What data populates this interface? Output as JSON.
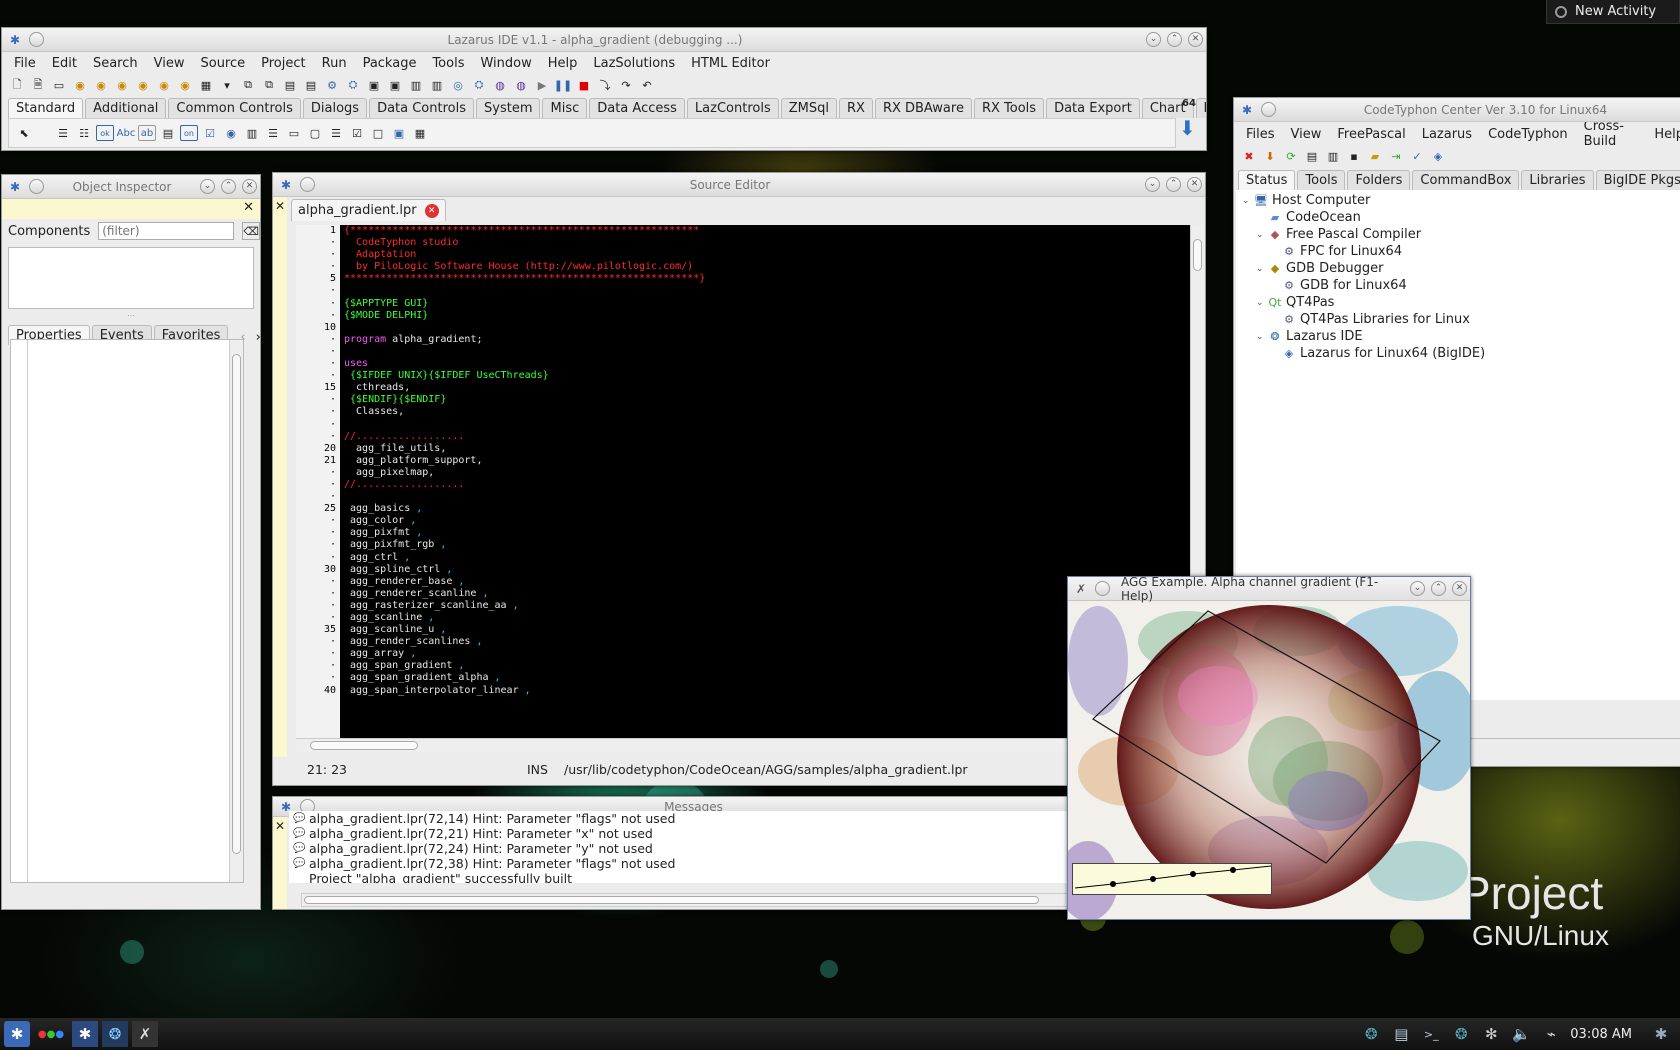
{
  "desktop": {
    "watermark_project": "Project",
    "watermark_os": "GNU/Linux",
    "new_activity": "New Activity"
  },
  "ide": {
    "title": "Lazarus IDE v1.1 - alpha_gradient (debugging ...)",
    "menu": [
      "File",
      "Edit",
      "Search",
      "View",
      "Source",
      "Project",
      "Run",
      "Package",
      "Tools",
      "Window",
      "Help",
      "LazSolutions",
      "HTML Editor"
    ],
    "palette_tabs": [
      "Standard",
      "Additional",
      "Common Controls",
      "Dialogs",
      "Data Controls",
      "System",
      "Misc",
      "Data Access",
      "LazControls",
      "ZMSql",
      "RX",
      "RX DBAware",
      "RX Tools",
      "Data Export",
      "Chart",
      "La"
    ],
    "palette_arch_label": "64"
  },
  "object_inspector": {
    "title": "Object Inspector",
    "components_label": "Components",
    "filter_placeholder": "(filter)",
    "tabs": [
      "Properties",
      "Events",
      "Favorites"
    ]
  },
  "source_editor": {
    "title": "Source Editor",
    "tab": "alpha_gradient.lpr",
    "gutter": [
      "1",
      "·",
      "·",
      "·",
      "5",
      "·",
      "·",
      "·",
      "10",
      "·",
      "·",
      "·",
      "·",
      "15",
      "·",
      "·",
      "·",
      "·",
      "20",
      "21",
      "·",
      "·",
      "·",
      "25",
      "·",
      "·",
      "·",
      "·",
      "30",
      "·",
      "·",
      "·",
      "·",
      "35",
      "·",
      "·",
      "·",
      "·",
      "40"
    ],
    "code_lines": [
      [
        {
          "t": "{**********************************************************",
          "c": "red"
        }
      ],
      [
        {
          "t": "  CodeTyphon studio",
          "c": "red"
        }
      ],
      [
        {
          "t": "  Adaptation",
          "c": "red"
        }
      ],
      [
        {
          "t": "  by PiloLogic Software House (http://www.pilotlogic.com/)",
          "c": "red"
        }
      ],
      [
        {
          "t": "***********************************************************}",
          "c": "red"
        }
      ],
      [],
      [
        {
          "t": "{$APPTYPE GUI}",
          "c": "grn"
        }
      ],
      [
        {
          "t": "{$MODE DELPHI}",
          "c": "grn"
        }
      ],
      [],
      [
        {
          "t": "program ",
          "c": "kw"
        },
        {
          "t": "alpha_gradient;",
          "c": "wht"
        }
      ],
      [],
      [
        {
          "t": "uses",
          "c": "kw"
        }
      ],
      [
        {
          "t": " {$IFDEF UNIX}{$IFDEF UseCThreads}",
          "c": "grn"
        }
      ],
      [
        {
          "t": "  cthreads,",
          "c": "wht"
        }
      ],
      [
        {
          "t": " {$ENDIF}{$ENDIF}",
          "c": "grn"
        }
      ],
      [
        {
          "t": "  Classes,",
          "c": "wht"
        }
      ],
      [],
      [
        {
          "t": "//..................",
          "c": "red"
        }
      ],
      [
        {
          "t": "  agg_file_utils,",
          "c": "wht"
        }
      ],
      [
        {
          "t": "  agg_platform_support,",
          "c": "wht"
        }
      ],
      [
        {
          "t": "  agg_pixelmap,",
          "c": "wht"
        }
      ],
      [
        {
          "t": "//..................",
          "c": "red"
        }
      ],
      [],
      [
        {
          "t": " agg_basics ",
          "c": "wht"
        },
        {
          "t": ",",
          "c": "cyn"
        }
      ],
      [
        {
          "t": " agg_color ",
          "c": "wht"
        },
        {
          "t": ",",
          "c": "cyn"
        }
      ],
      [
        {
          "t": " agg_pixfmt ",
          "c": "wht"
        },
        {
          "t": ",",
          "c": "cyn"
        }
      ],
      [
        {
          "t": " agg_pixfmt_rgb ",
          "c": "wht"
        },
        {
          "t": ",",
          "c": "cyn"
        }
      ],
      [
        {
          "t": " agg_ctrl ",
          "c": "wht"
        },
        {
          "t": ",",
          "c": "cyn"
        }
      ],
      [
        {
          "t": " agg_spline_ctrl ",
          "c": "wht"
        },
        {
          "t": ",",
          "c": "cyn"
        }
      ],
      [
        {
          "t": " agg_renderer_base ",
          "c": "wht"
        },
        {
          "t": ",",
          "c": "cyn"
        }
      ],
      [
        {
          "t": " agg_renderer_scanline ",
          "c": "wht"
        },
        {
          "t": ",",
          "c": "cyn"
        }
      ],
      [
        {
          "t": " agg_rasterizer_scanline_aa ",
          "c": "wht"
        },
        {
          "t": ",",
          "c": "cyn"
        }
      ],
      [
        {
          "t": " agg_scanline ",
          "c": "wht"
        },
        {
          "t": ",",
          "c": "cyn"
        }
      ],
      [
        {
          "t": " agg_scanline_u ",
          "c": "wht"
        },
        {
          "t": ",",
          "c": "cyn"
        }
      ],
      [
        {
          "t": " agg_render_scanlines ",
          "c": "wht"
        },
        {
          "t": ",",
          "c": "cyn"
        }
      ],
      [
        {
          "t": " agg_array ",
          "c": "wht"
        },
        {
          "t": ",",
          "c": "cyn"
        }
      ],
      [
        {
          "t": " agg_span_gradient ",
          "c": "wht"
        },
        {
          "t": ",",
          "c": "cyn"
        }
      ],
      [
        {
          "t": " agg_span_gradient_alpha ",
          "c": "wht"
        },
        {
          "t": ",",
          "c": "cyn"
        }
      ],
      [
        {
          "t": " agg_span_interpolator_linear ",
          "c": "wht"
        },
        {
          "t": ",",
          "c": "cyn"
        }
      ]
    ],
    "status_pos": "21: 23",
    "status_mode": "INS",
    "status_path": "/usr/lib/codetyphon/CodeOcean/AGG/samples/alpha_gradient.lpr"
  },
  "messages": {
    "title": "Messages",
    "items": [
      {
        "text": "alpha_gradient.lpr(72,14) Hint: Parameter \"flags\" not used",
        "icon": true
      },
      {
        "text": "alpha_gradient.lpr(72,21) Hint: Parameter \"x\" not used",
        "icon": true
      },
      {
        "text": "alpha_gradient.lpr(72,24) Hint: Parameter \"y\" not used",
        "icon": true
      },
      {
        "text": "alpha_gradient.lpr(72,38) Hint: Parameter \"flags\" not used",
        "icon": true
      },
      {
        "text": "Project \"alpha_gradient\" successfully built",
        "icon": false
      }
    ]
  },
  "center": {
    "title": "CodeTyphon Center Ver 3.10 for Linux64",
    "menu": [
      "Files",
      "View",
      "FreePascal",
      "Lazarus",
      "CodeTyphon",
      "Cross-Build",
      "Help"
    ],
    "tabs": [
      "Status",
      "Tools",
      "Folders",
      "CommandBox",
      "Libraries",
      "BigIDE Pkgs"
    ],
    "tree": [
      {
        "label": "Host Computer",
        "level": 0,
        "icon": "computer-icon",
        "exp": "v"
      },
      {
        "label": "CodeOcean",
        "level": 1,
        "icon": "folder-icon",
        "exp": ""
      },
      {
        "label": "Free Pascal Compiler",
        "level": 1,
        "icon": "fpc-icon",
        "exp": "v"
      },
      {
        "label": "FPC for Linux64",
        "level": 2,
        "icon": "gear-icon",
        "exp": ""
      },
      {
        "label": "GDB Debugger",
        "level": 1,
        "icon": "gdb-icon",
        "exp": "v"
      },
      {
        "label": "GDB for Linux64",
        "level": 2,
        "icon": "gear-icon",
        "exp": ""
      },
      {
        "label": "QT4Pas",
        "level": 1,
        "icon": "qt-icon",
        "exp": "v"
      },
      {
        "label": "QT4Pas Libraries for Linux",
        "level": 2,
        "icon": "gear-icon",
        "exp": ""
      },
      {
        "label": "Lazarus IDE",
        "level": 1,
        "icon": "lazarus-icon",
        "exp": "v"
      },
      {
        "label": "Lazarus for Linux64 (BigIDE)",
        "level": 2,
        "icon": "lazarus64-icon",
        "exp": ""
      }
    ]
  },
  "agg": {
    "title": "AGG Example. Alpha channel gradient (F1-Help)"
  },
  "taskbar": {
    "clock": "03:08 AM"
  }
}
